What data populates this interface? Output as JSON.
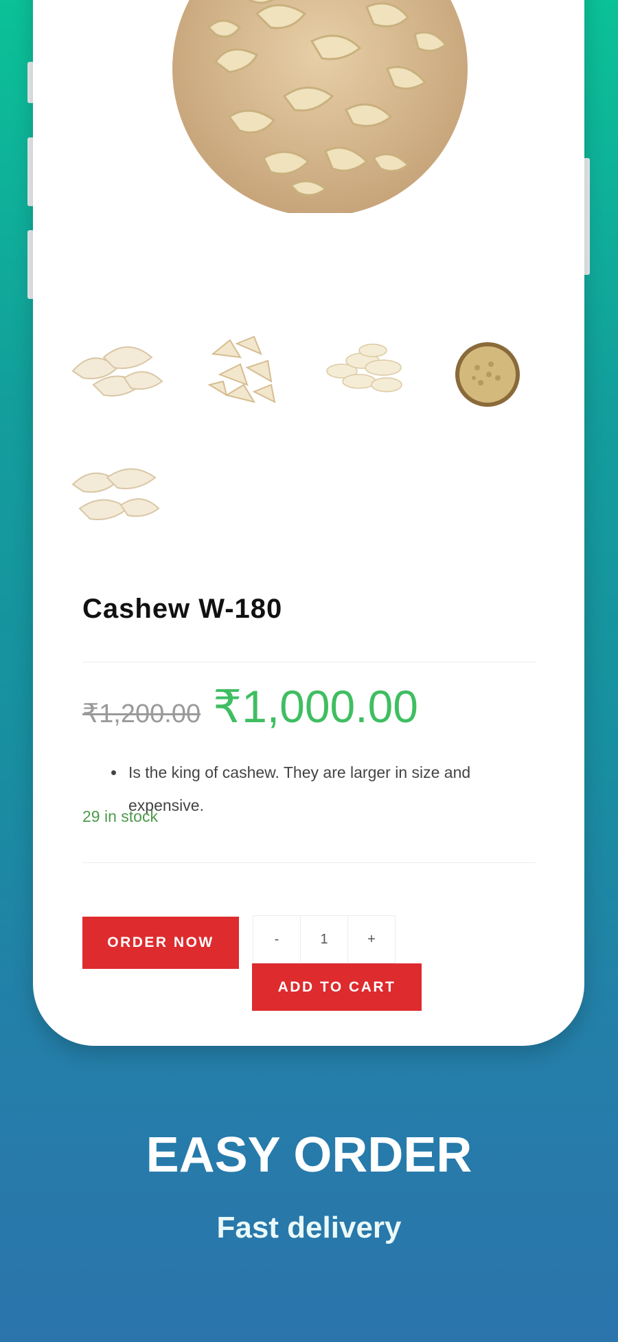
{
  "product": {
    "title": "Cashew W-180",
    "old_price": "₹1,200.00",
    "price": "₹1,000.00",
    "description": "Is the king of cashew. They are larger in size and expensive.",
    "stock": "29 in stock"
  },
  "quantity": {
    "decrement_label": "-",
    "value": "1",
    "increment_label": "+"
  },
  "buttons": {
    "order_now": "ORDER NOW",
    "add_to_cart": "ADD TO CART"
  },
  "promo": {
    "headline": "EASY ORDER",
    "subline": "Fast delivery"
  },
  "colors": {
    "accent_red": "#de2b2e",
    "price_green": "#3fbe61",
    "stock_green": "#4c9a4a"
  }
}
